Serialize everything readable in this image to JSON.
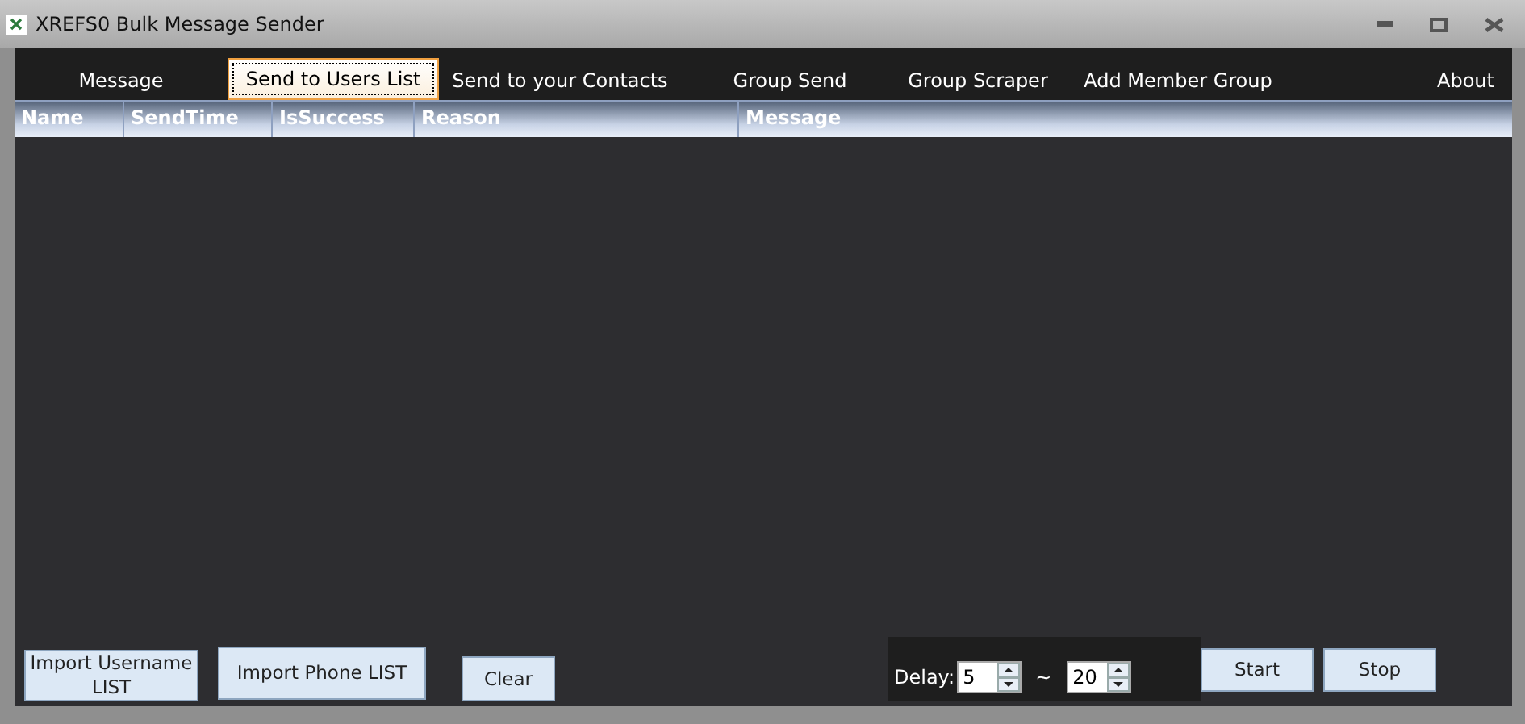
{
  "window": {
    "title": "XREFS0 Bulk Message Sender"
  },
  "tabs": [
    {
      "label": "Message",
      "selected": false
    },
    {
      "label": "Send to Users List",
      "selected": true
    },
    {
      "label": "Send to your Contacts",
      "selected": false
    },
    {
      "label": "Group Send",
      "selected": false
    },
    {
      "label": "Group Scraper",
      "selected": false
    },
    {
      "label": "Add Member Group",
      "selected": false
    },
    {
      "label": "About",
      "selected": false
    }
  ],
  "table": {
    "columns": [
      "Name",
      "SendTime",
      "IsSuccess",
      "Reason",
      "Message"
    ]
  },
  "import_buttons": [
    "Import Username LIST",
    "Import Phone LIST",
    "Clear"
  ],
  "delay": {
    "label": "Delay:",
    "min": "5",
    "separator": "~",
    "max": "20"
  },
  "run_buttons": [
    "Start",
    "Stop"
  ]
}
